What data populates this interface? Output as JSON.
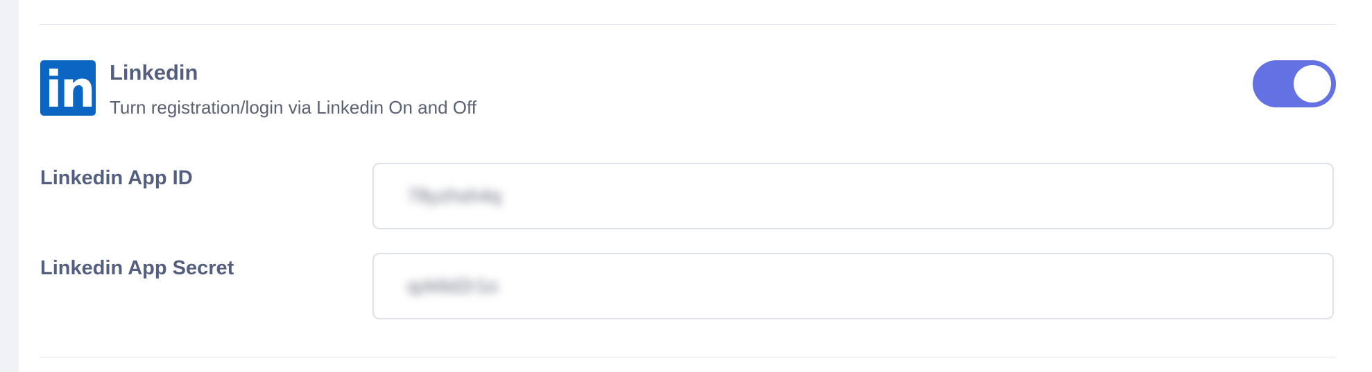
{
  "provider": {
    "logo_text": "in",
    "title": "Linkedin",
    "description": "Turn registration/login via Linkedin On and Off",
    "enabled": true,
    "brand_color": "#0a66c2",
    "toggle_color": "#6371e3"
  },
  "fields": {
    "app_id": {
      "label": "Linkedin App ID",
      "value": "78yzhsh4q"
    },
    "app_secret": {
      "label": "Linkedin App Secret",
      "value": "qzk6d2r1o"
    }
  }
}
